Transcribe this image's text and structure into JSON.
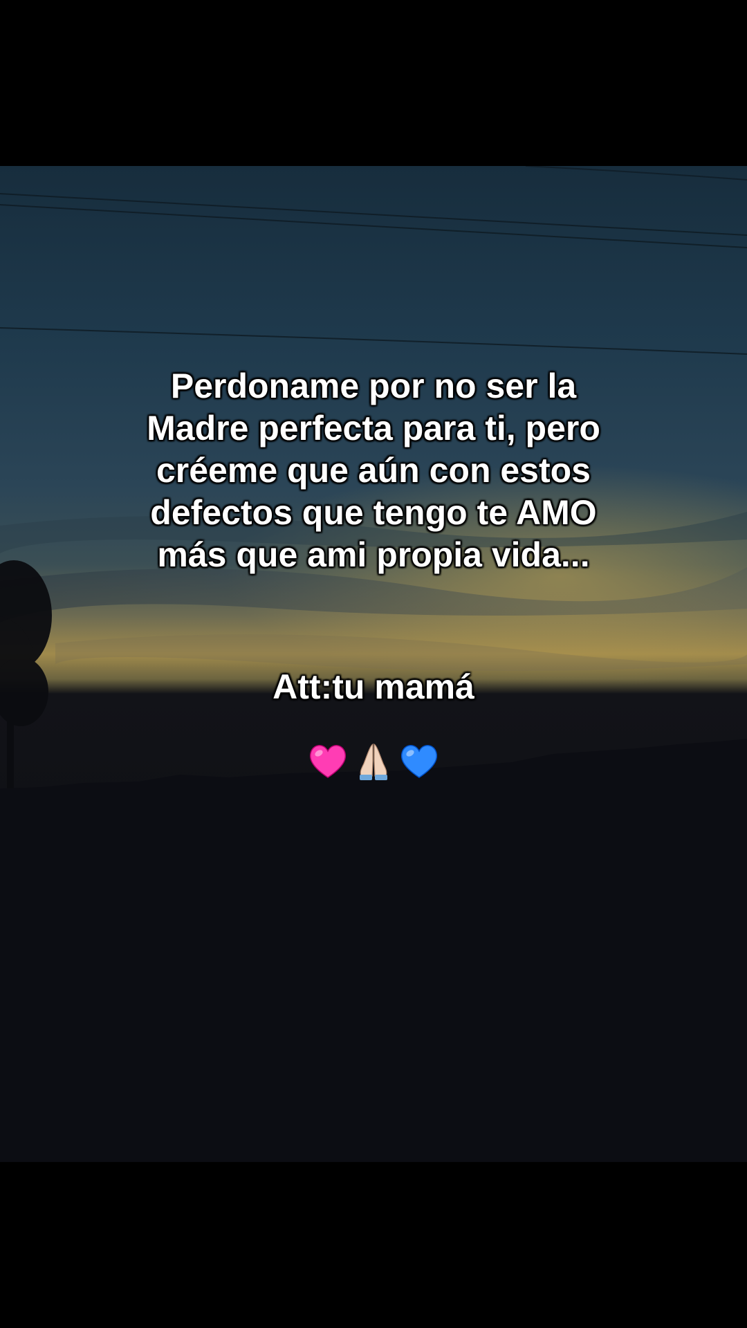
{
  "message": {
    "lines": [
      "Perdoname por no ser la",
      "Madre perfecta para ti, pero",
      "créeme que aún con estos",
      "defectos que tengo te AMO",
      "más que ami propia vida..."
    ]
  },
  "signature": "Att:tu mamá",
  "emojis": [
    "pink-heart-icon",
    "folded-hands-icon",
    "blue-heart-icon"
  ],
  "colors": {
    "sky_top": "#1c3547",
    "sky_mid": "#2f4a5c",
    "sunset_glow": "#b89a4e",
    "ground": "#0b0c12",
    "text": "#ffffff",
    "pink_heart": "#ff3db4",
    "blue_heart": "#2f8bff"
  }
}
